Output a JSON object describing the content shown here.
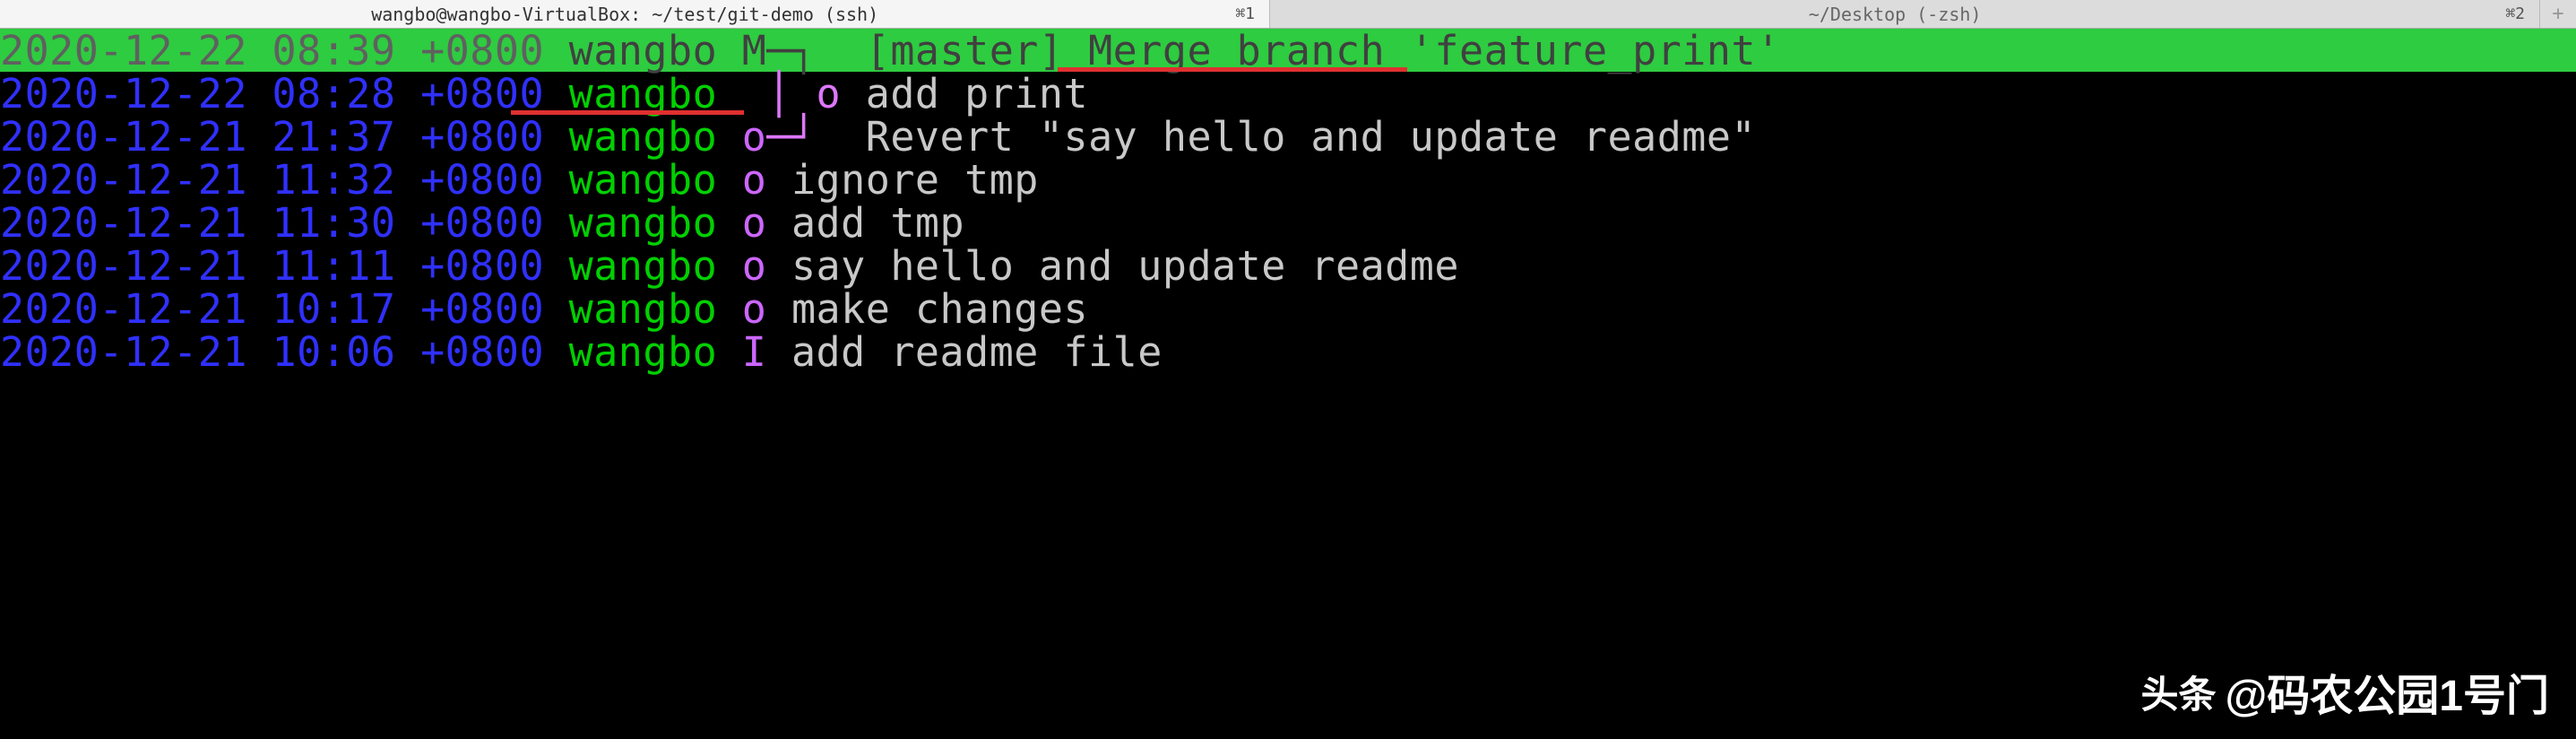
{
  "tabs": [
    {
      "title": "wangbo@wangbo-VirtualBox: ~/test/git-demo (ssh)",
      "shortcut": "⌘1",
      "active": true
    },
    {
      "title": "~/Desktop (-zsh)",
      "shortcut": "⌘2",
      "active": false
    }
  ],
  "tab_add": "+",
  "commits": [
    {
      "date": "2020-12-22 08:39 +0800",
      "author": "wangbo",
      "marker": "M",
      "graph": "─┐ ",
      "branch": "[master]",
      "message": "Merge branch 'feature_print'",
      "selected": true,
      "underline_message": true,
      "underline_start": 1180,
      "underline_width": 390
    },
    {
      "date": "2020-12-22 08:28 +0800",
      "author": "wangbo",
      "marker": "",
      "graph": "│ o",
      "branch": "",
      "message": "add print",
      "selected": false,
      "underline_message": true,
      "underline_start": 570,
      "underline_width": 260
    },
    {
      "date": "2020-12-21 21:37 +0800",
      "author": "wangbo",
      "marker": "o",
      "graph": "─┘ ",
      "branch": "",
      "message": "Revert \"say hello and update readme\"",
      "selected": false
    },
    {
      "date": "2020-12-21 11:32 +0800",
      "author": "wangbo",
      "marker": "o",
      "graph": "",
      "branch": "",
      "message": "ignore tmp",
      "selected": false
    },
    {
      "date": "2020-12-21 11:30 +0800",
      "author": "wangbo",
      "marker": "o",
      "graph": "",
      "branch": "",
      "message": "add tmp",
      "selected": false
    },
    {
      "date": "2020-12-21 11:11 +0800",
      "author": "wangbo",
      "marker": "o",
      "graph": "",
      "branch": "",
      "message": "say hello and update readme",
      "selected": false
    },
    {
      "date": "2020-12-21 10:17 +0800",
      "author": "wangbo",
      "marker": "o",
      "graph": "",
      "branch": "",
      "message": "make changes",
      "selected": false
    },
    {
      "date": "2020-12-21 10:06 +0800",
      "author": "wangbo",
      "marker": "I",
      "graph": "",
      "branch": "",
      "message": "add readme file",
      "selected": false
    }
  ],
  "watermark": {
    "prefix": "头条",
    "text": "@码农公园1号门"
  }
}
